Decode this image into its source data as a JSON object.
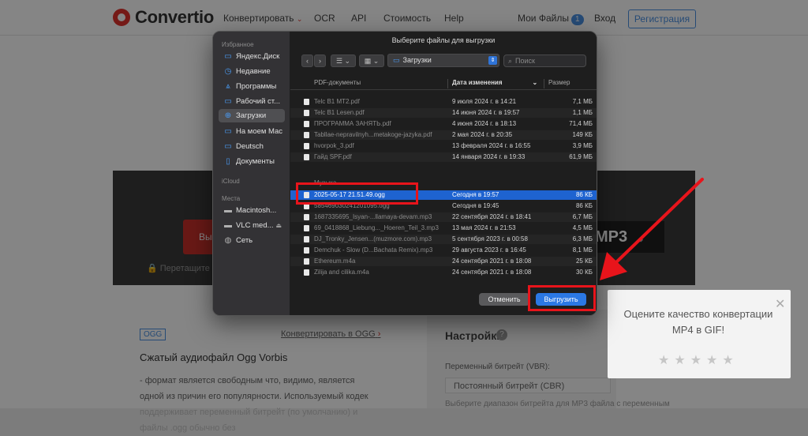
{
  "site": {
    "logo": "Convertio",
    "nav": [
      "Конвертировать",
      "OCR",
      "API",
      "Стоимость",
      "Help"
    ],
    "my_files": "Мои Файлы",
    "my_files_count": "1",
    "login": "Вход",
    "register": "Регистрация",
    "red_button": "Вы",
    "mp3": "MP3",
    "drag_text": "Перетащите фай",
    "ogg_tag": "OGG",
    "convert_link": "Конвертировать в OGG",
    "ogg_title": "Сжатый аудиофайл Ogg Vorbis",
    "ogg_desc": "- формат является свободным что, видимо, является одной из причин его популярности. Используемый кодек поддерживает переменный битрейт (по умолчанию) и файлы .ogg обычно без",
    "settings_title": "Настройки",
    "vbr_label": "Переменный битрейт (VBR):",
    "vbr_value": "Постоянный битрейт (CBR)",
    "vbr_note": "Выберите диапазон битрейта для MP3 файла с переменным"
  },
  "rating": {
    "text": "Оцените качество конвертации MP4 в GIF!",
    "stars": "★★★★★"
  },
  "dialog": {
    "title": "Выберите файлы для выгрузки",
    "location": "Загрузки",
    "search_placeholder": "Поиск",
    "sidebar": {
      "favorites_label": "Избранное",
      "icloud_label": "iCloud",
      "places_label": "Места",
      "favorites": [
        {
          "label": "Яндекс.Диск",
          "icon": "folder"
        },
        {
          "label": "Недавние",
          "icon": "clock"
        },
        {
          "label": "Программы",
          "icon": "apps"
        },
        {
          "label": "Рабочий ст...",
          "icon": "desktop"
        },
        {
          "label": "Загрузки",
          "icon": "download"
        },
        {
          "label": "На моем Mac",
          "icon": "folder"
        },
        {
          "label": "Deutsch",
          "icon": "folder"
        },
        {
          "label": "Документы",
          "icon": "document"
        }
      ],
      "places": [
        {
          "label": "Macintosh...",
          "icon": "disk"
        },
        {
          "label": "VLC med...",
          "icon": "disk"
        },
        {
          "label": "Сеть",
          "icon": "globe"
        }
      ]
    },
    "columns": {
      "group": "PDF-документы",
      "date": "Дата изменения",
      "size": "Размер"
    },
    "pdf_files": [
      {
        "name": "Telc B1 MT2.pdf",
        "date": "9 июля 2024 г. в 14:21",
        "size": "7,1 МБ"
      },
      {
        "name": "Telc B1 Lesen.pdf",
        "date": "14 июня 2024 г. в 19:57",
        "size": "1,1 МБ"
      },
      {
        "name": "ПРОГРАММА ЗАНЯТЬ.pdf",
        "date": "4 июня 2024 г. в 18:13",
        "size": "71,4 МБ"
      },
      {
        "name": "Tabllae-nepravilnyh...metakoge-jazyka.pdf",
        "date": "2 мая 2024 г. в 20:35",
        "size": "149 КБ"
      },
      {
        "name": "hvorpok_3.pdf",
        "date": "13 февраля 2024 г. в 16:55",
        "size": "3,9 МБ"
      },
      {
        "name": "Гайд SPF.pdf",
        "date": "14 января 2024 г. в 19:33",
        "size": "61,9 МБ"
      }
    ],
    "music_group": "Музыка",
    "music_files": [
      {
        "name": "2025-05-17 21.51.49.ogg",
        "date": "Сегодня в 19:57",
        "size": "86 КБ",
        "selected": true
      },
      {
        "name": "585469030241201095.ogg",
        "date": "Сегодня в 19:45",
        "size": "86 КБ"
      },
      {
        "name": "1687335695_Isyan-...llamaya-devam.mp3",
        "date": "22 сентября 2024 г. в 18:41",
        "size": "6,7 МБ"
      },
      {
        "name": "69_0418868_Liebung..._Hoeren_Teil_3.mp3",
        "date": "13 мая 2024 г. в 21:53",
        "size": "4,5 МБ"
      },
      {
        "name": "DJ_Tronky_Jensen...(muzmore.com).mp3",
        "date": "5 сентября 2023 г. в 00:58",
        "size": "6,3 МБ"
      },
      {
        "name": "Demchuk - Slow (D...Bachata Remix).mp3",
        "date": "29 августа 2023 г. в 16:45",
        "size": "8,1 МБ"
      },
      {
        "name": "Ethereum.m4a",
        "date": "24 сентября 2021 г. в 18:08",
        "size": "25 КБ"
      },
      {
        "name": "Zilija and cilika.m4a",
        "date": "24 сентября 2021 г. в 18:08",
        "size": "30 КБ"
      }
    ],
    "cancel": "Отменить",
    "upload": "Выгрузить"
  },
  "colors": {
    "highlight": "#e8141b",
    "selection": "#1e63d0",
    "accent": "#2b78e4"
  }
}
